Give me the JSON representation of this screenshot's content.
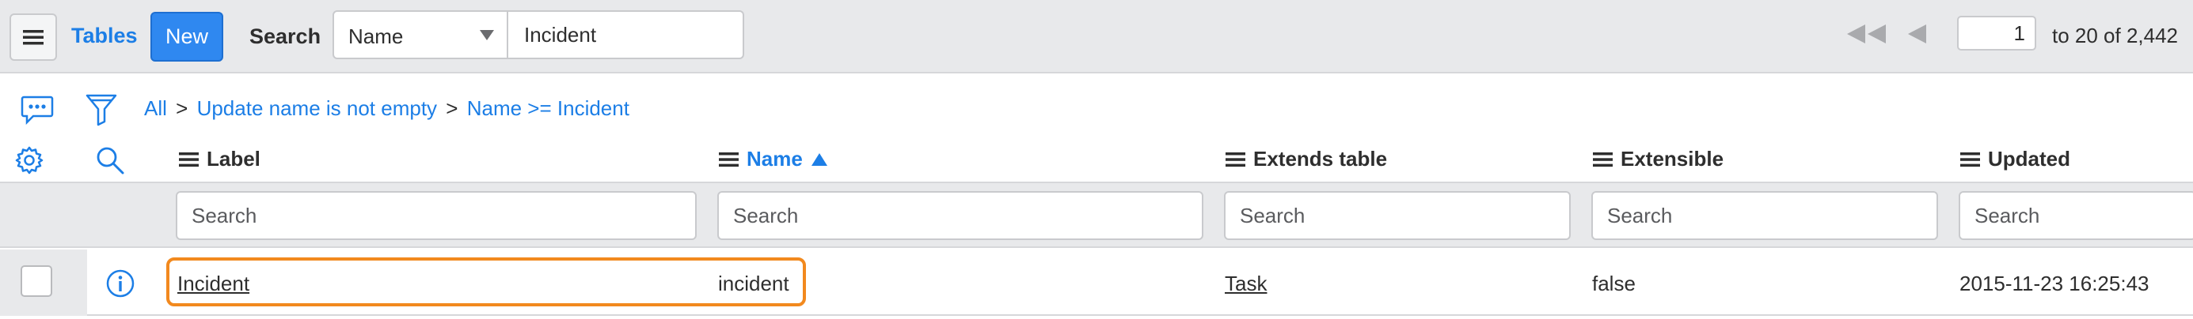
{
  "header": {
    "menu_icon": "hamburger-icon",
    "tables_label": "Tables",
    "new_label": "New",
    "search_label": "Search",
    "field_selected": "Name",
    "search_value": "Incident",
    "page_value": "1",
    "range_text": "to 20 of 2,442",
    "nav_first_icon": "first-page-icon",
    "nav_prev_icon": "previous-page-icon"
  },
  "toolbar": {
    "icons": [
      "chat-icon",
      "filter-icon",
      "gear-icon",
      "search-icon"
    ]
  },
  "breadcrumb": {
    "items": [
      "All",
      "Update name is not empty",
      "Name >= Incident"
    ],
    "separator": ">"
  },
  "columns": [
    {
      "label": "Label",
      "sorted": false
    },
    {
      "label": "Name",
      "sorted": true
    },
    {
      "label": "Extends table",
      "sorted": false
    },
    {
      "label": "Extensible",
      "sorted": false
    },
    {
      "label": "Updated",
      "sorted": false
    }
  ],
  "search_placeholder": "Search",
  "rows": [
    {
      "label": "Incident",
      "name": "incident",
      "extends_table": "Task",
      "extensible": "false",
      "updated": "2015-11-23 16:25:43"
    }
  ],
  "colors": {
    "accent": "#1c7ee6",
    "new_button": "#2f88f0",
    "highlight": "#f2891e",
    "header_bg": "#e8e9eb"
  }
}
